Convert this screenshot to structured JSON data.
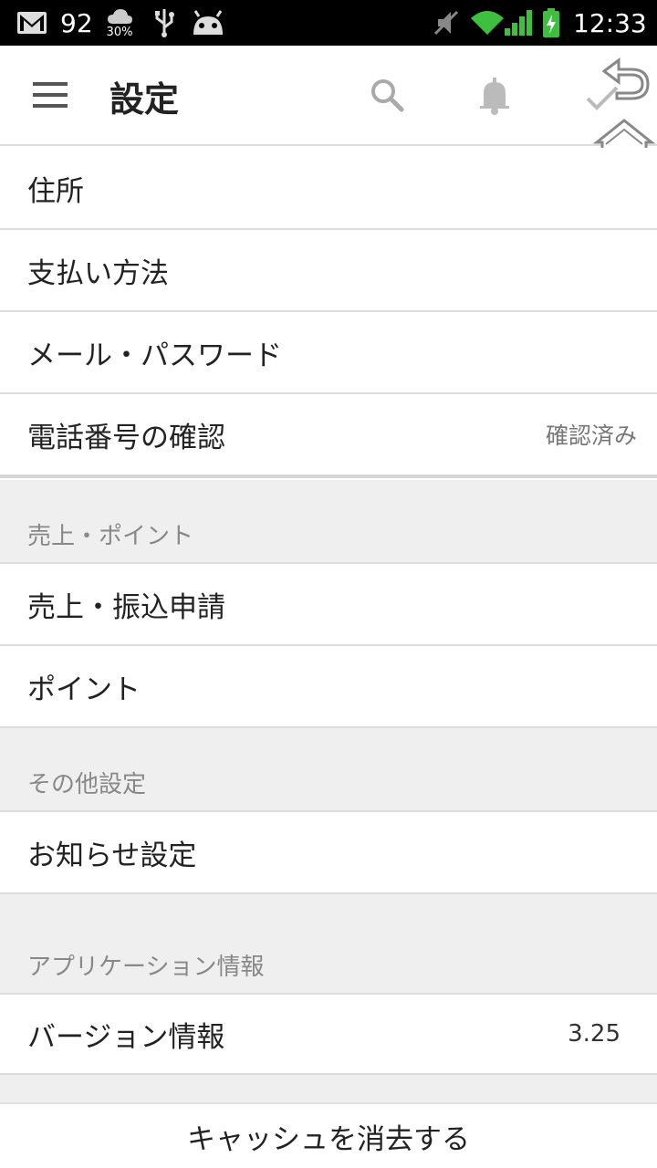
{
  "status_bar": {
    "notification_count": "92",
    "weather_percent": "30%",
    "time": "12:33"
  },
  "header": {
    "title": "設定"
  },
  "account_rows": [
    {
      "label": "住所"
    },
    {
      "label": "支払い方法"
    },
    {
      "label": "メール・パスワード"
    },
    {
      "label": "電話番号の確認",
      "value": "確認済み"
    }
  ],
  "sections": {
    "sales": {
      "title": "売上・ポイント",
      "rows": [
        {
          "label": "売上・振込申請"
        },
        {
          "label": "ポイント"
        }
      ]
    },
    "other": {
      "title": "その他設定",
      "rows": [
        {
          "label": "お知らせ設定"
        }
      ]
    },
    "app_info": {
      "title": "アプリケーション情報",
      "rows": [
        {
          "label": "バージョン情報",
          "value": "3.25"
        }
      ]
    }
  },
  "footer": {
    "clear_cache_label": "キャッシュを消去する"
  }
}
